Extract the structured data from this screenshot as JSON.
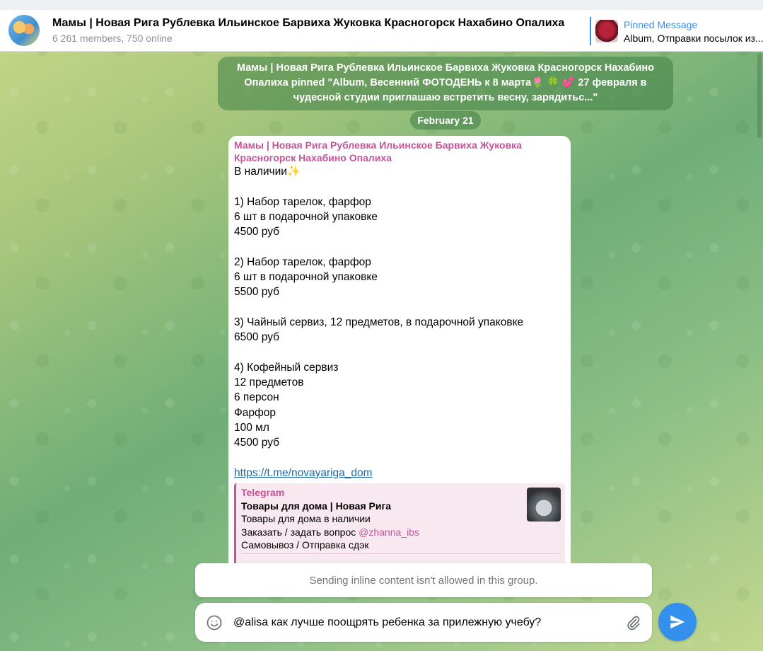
{
  "header": {
    "chat_title": "Мамы | Новая Рига Рублевка Ильинское Барвиха Жуковка Красногорск Нахабино Опалиха",
    "chat_subtitle": "6 261 members, 750 online",
    "pinned_label": "Pinned Message",
    "pinned_preview": "Album, Отправки посылок из..."
  },
  "service_message": "Мамы | Новая Рига Рублевка Ильинское Барвиха Жуковка Красногорск Нахабино Опалиха pinned \"Album, Весенний ФОТОДЕНЬ к 8 марта🌷 🍀 💕 27 февраля в чудесной студии приглашаю встретить весну, зарядитьс...\"",
  "date_separator": "February 21",
  "message": {
    "sender": "Мамы | Новая Рига Рублевка Ильинское Барвиха Жуковка Красногорск Нахабино Опалиха",
    "lines": [
      "В наличии✨",
      "",
      "1) Набор тарелок, фарфор",
      "6 шт в подарочной упаковке",
      "4500 руб",
      "",
      "2) Набор тарелок, фарфор",
      "6 шт в подарочной упаковке",
      "5500 руб",
      "",
      "3) Чайный сервиз, 12 предметов, в подарочной упаковке",
      "6500 руб",
      "",
      "4) Кофейный сервиз",
      "12 предметов",
      "6 персон",
      "Фарфор",
      "100 мл",
      "4500 руб",
      ""
    ],
    "link": "https://t.me/novayariga_dom",
    "preview": {
      "site": "Telegram",
      "title": "Товары для дома | Новая Рига",
      "line1": "Товары для дома в наличии",
      "line2_prefix": "Заказать / задать вопрос ",
      "line2_mention": "@zhanna_ibs",
      "line3": "Самовывоз / Отправка сдэк"
    }
  },
  "notice": "Sending inline content isn't allowed in this group.",
  "composer": {
    "value": "@alisa как лучше поощрять ребенка за прилежную учебу?"
  },
  "colors": {
    "accent": "#3390ec",
    "sender": "#c4539a"
  },
  "icons": {
    "emoji": "smile-icon",
    "attach": "paperclip-icon",
    "send": "send-icon"
  }
}
